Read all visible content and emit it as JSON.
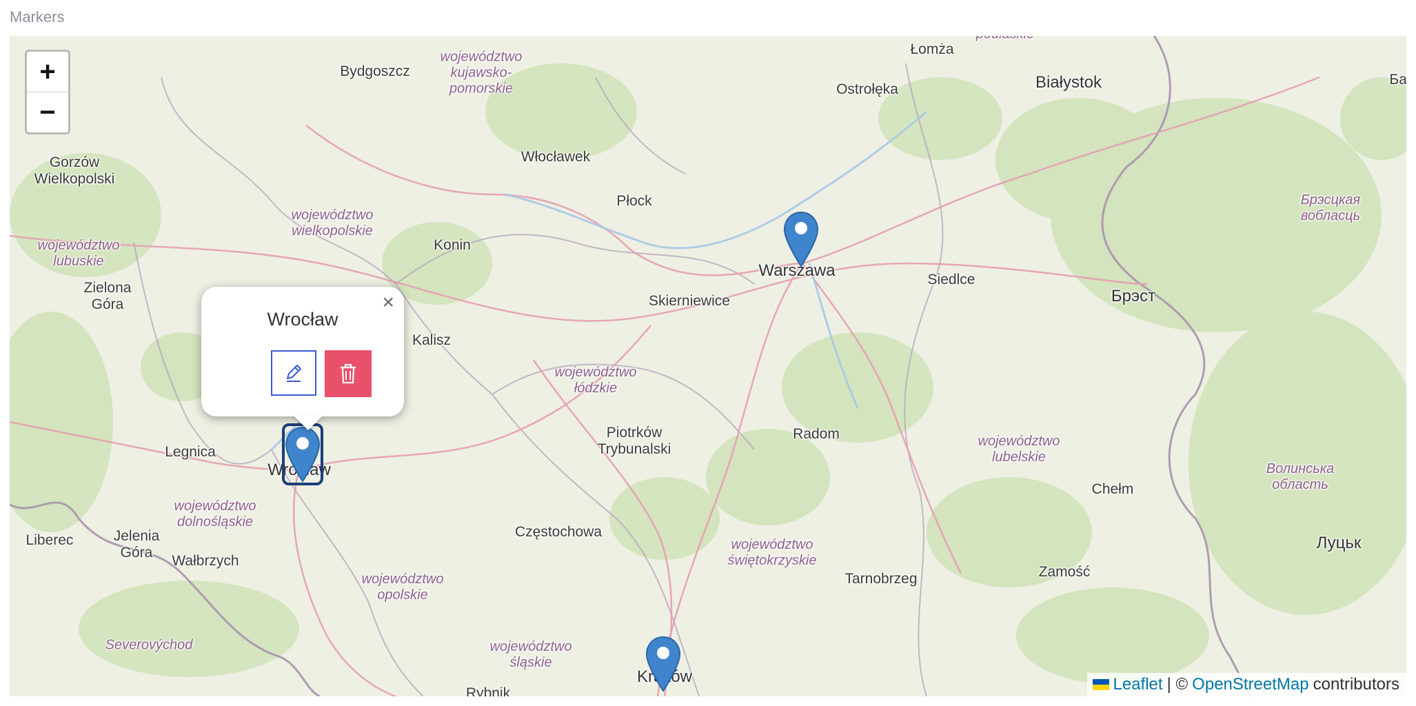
{
  "section": {
    "title": "Markers"
  },
  "map": {
    "zoom_in_label": "+",
    "zoom_out_label": "−",
    "places": [
      {
        "id": "bydgoszcz",
        "label": "Bydgoszcz",
        "kind": "city"
      },
      {
        "id": "wloclawek",
        "label": "Włocławek",
        "kind": "city"
      },
      {
        "id": "lomza",
        "label": "Łomża",
        "kind": "city"
      },
      {
        "id": "ostroleka",
        "label": "Ostrołęka",
        "kind": "city"
      },
      {
        "id": "bialystok",
        "label": "Białystok",
        "kind": "capital"
      },
      {
        "id": "gorzow",
        "label": "Gorzów\nWielkopolski",
        "kind": "city"
      },
      {
        "id": "plock",
        "label": "Płock",
        "kind": "city"
      },
      {
        "id": "konin",
        "label": "Konin",
        "kind": "city"
      },
      {
        "id": "warszawa",
        "label": "Warszawa",
        "kind": "capital"
      },
      {
        "id": "siedlce",
        "label": "Siedlce",
        "kind": "city"
      },
      {
        "id": "brest",
        "label": "Брэст",
        "kind": "capital"
      },
      {
        "id": "zielona",
        "label": "Zielona\nGóra",
        "kind": "city"
      },
      {
        "id": "skierniewice",
        "label": "Skierniewice",
        "kind": "city"
      },
      {
        "id": "kalisz",
        "label": "Kalisz",
        "kind": "city"
      },
      {
        "id": "piotrkow",
        "label": "Piotrków\nTrybunalski",
        "kind": "city"
      },
      {
        "id": "radom",
        "label": "Radom",
        "kind": "city"
      },
      {
        "id": "legnica",
        "label": "Legnica",
        "kind": "city"
      },
      {
        "id": "wroclaw",
        "label": "Wrocław",
        "kind": "capital"
      },
      {
        "id": "chelm",
        "label": "Chełm",
        "kind": "city"
      },
      {
        "id": "liberec",
        "label": "Liberec",
        "kind": "city"
      },
      {
        "id": "jelenia",
        "label": "Jelenia\nGóra",
        "kind": "city"
      },
      {
        "id": "walbrzych",
        "label": "Wałbrzych",
        "kind": "city"
      },
      {
        "id": "czestochowa",
        "label": "Częstochowa",
        "kind": "city"
      },
      {
        "id": "tarnobrzeg",
        "label": "Tarnobrzeg",
        "kind": "city"
      },
      {
        "id": "zamosc",
        "label": "Zamość",
        "kind": "city"
      },
      {
        "id": "lutsk",
        "label": "Луцьк",
        "kind": "capital"
      },
      {
        "id": "krakow",
        "label": "Kraków",
        "kind": "capital"
      },
      {
        "id": "rybnik",
        "label": "Rybnik",
        "kind": "city"
      },
      {
        "id": "r_kuj",
        "label": "województwo\nkujawsko-\npomorskie",
        "kind": "region"
      },
      {
        "id": "r_podl",
        "label": "podlaskie",
        "kind": "region"
      },
      {
        "id": "r_wlkp",
        "label": "województwo\nwielkopolskie",
        "kind": "region"
      },
      {
        "id": "r_lubu",
        "label": "województwo\nlubuskie",
        "kind": "region"
      },
      {
        "id": "r_brest",
        "label": "Брэсцкая\nвобласць",
        "kind": "region"
      },
      {
        "id": "r_lodz",
        "label": "województwo\nłódzkie",
        "kind": "region"
      },
      {
        "id": "r_lub",
        "label": "województwo\nlubelskie",
        "kind": "region"
      },
      {
        "id": "r_dsl",
        "label": "województwo\ndolnośląskie",
        "kind": "region"
      },
      {
        "id": "r_vol",
        "label": "Волинська\nобласть",
        "kind": "region"
      },
      {
        "id": "r_swk",
        "label": "województwo\nświętokrzyskie",
        "kind": "region"
      },
      {
        "id": "r_opol",
        "label": "województwo\nopolskie",
        "kind": "region"
      },
      {
        "id": "r_sev",
        "label": "Severovýchod",
        "kind": "region"
      },
      {
        "id": "r_slask",
        "label": "województwo\nśląskie",
        "kind": "region"
      },
      {
        "id": "r_bar",
        "label": "Бар",
        "kind": "city"
      }
    ],
    "markers": [
      {
        "id": "warszawa",
        "selected": false
      },
      {
        "id": "wroclaw",
        "selected": true
      },
      {
        "id": "krakow",
        "selected": false
      }
    ]
  },
  "popup": {
    "title": "Wrocław",
    "close_label": "×",
    "edit_icon": "pencil-icon",
    "delete_icon": "trash-icon",
    "delete_color": "#e8506b",
    "edit_color": "#3b5bd1"
  },
  "attribution": {
    "leaflet": "Leaflet",
    "separator": "| ©",
    "osm": "OpenStreetMap",
    "suffix": "contributors"
  },
  "colors": {
    "marker": "#3f84cc",
    "region_label": "#8f5e8c",
    "link": "#0078a8"
  }
}
